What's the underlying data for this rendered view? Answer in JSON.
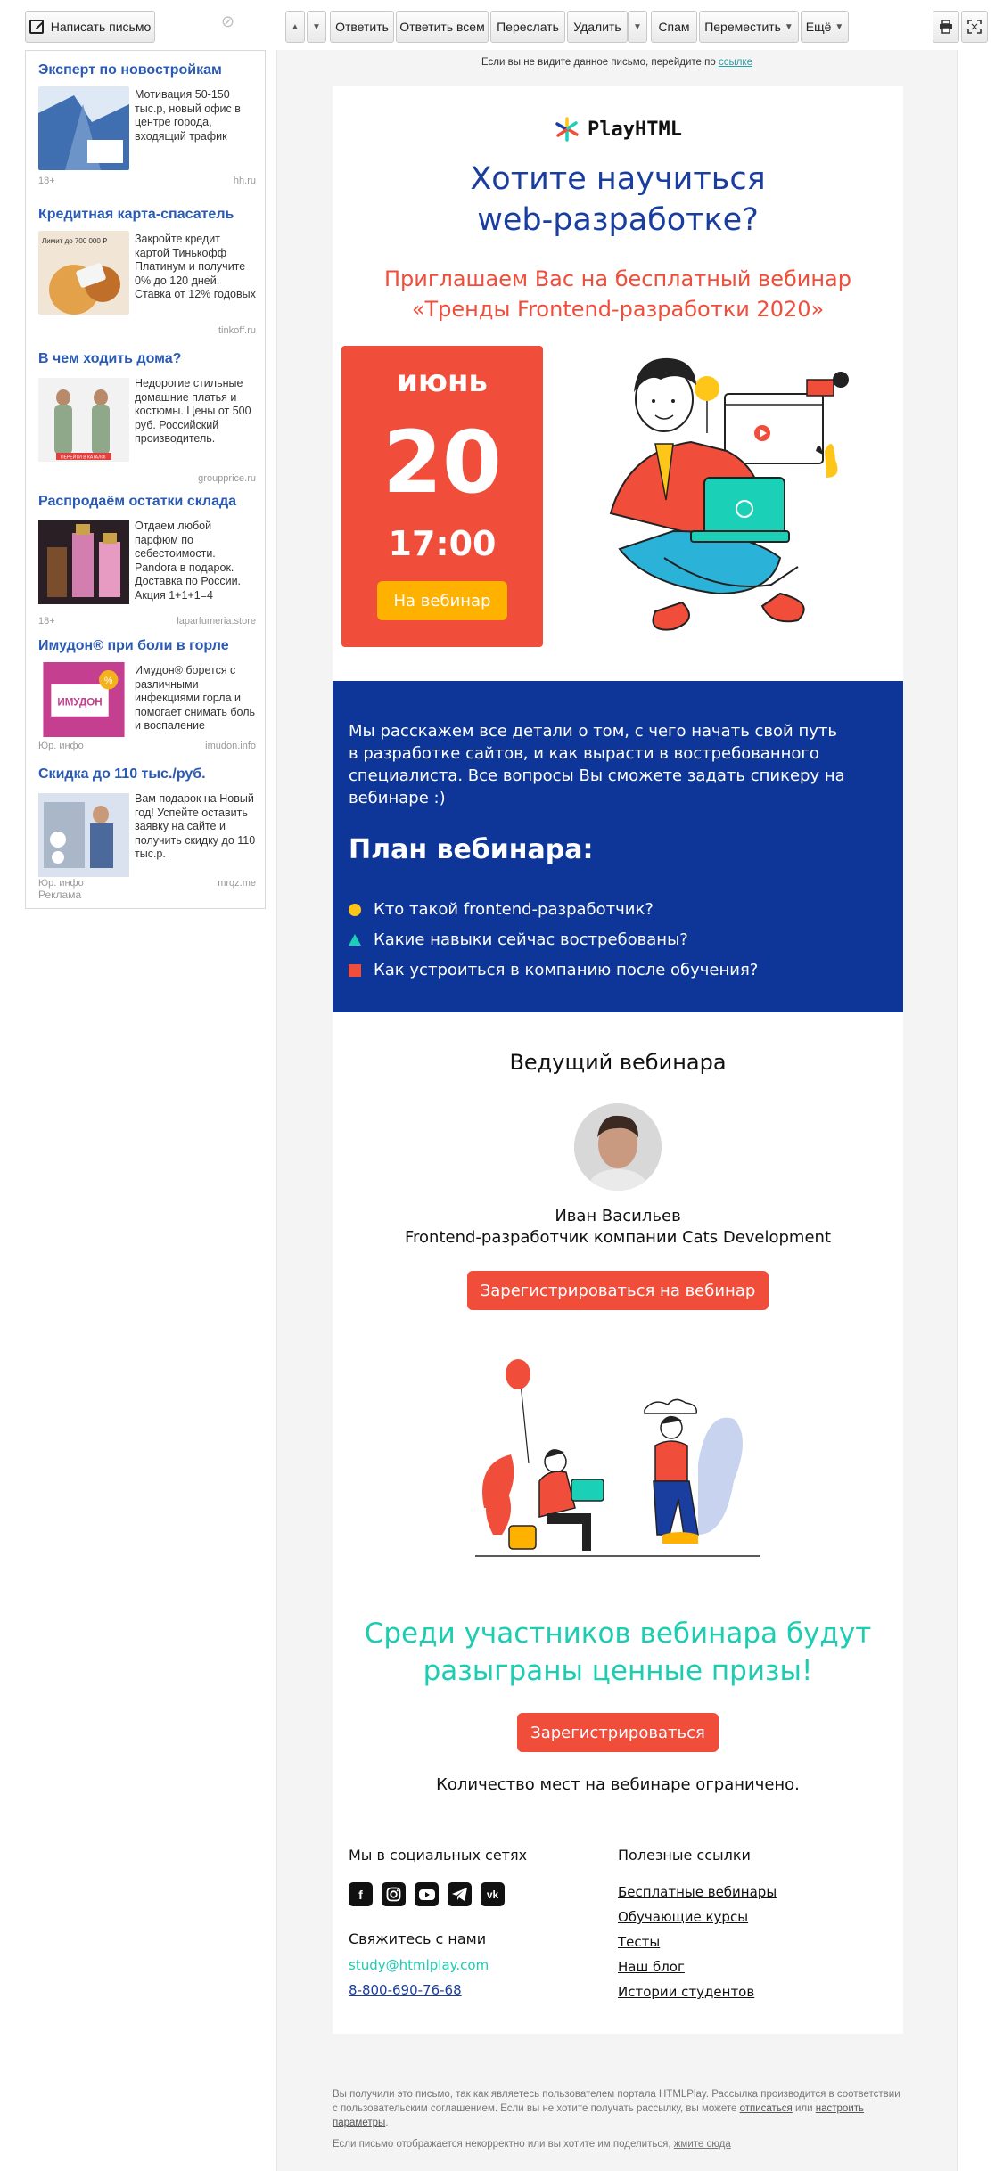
{
  "toolbar": {
    "compose": "Написать письмо",
    "reply": "Ответить",
    "reply_all": "Ответить всем",
    "forward": "Переслать",
    "delete": "Удалить",
    "spam": "Спам",
    "move": "Переместить",
    "more": "Ещё"
  },
  "ads": {
    "label": "Реклама",
    "items": [
      {
        "title": "Эксперт по новостройкам",
        "text": "Мотивация 50-150 тыс.р, новый офис в центре города, входящий трафик",
        "foot_left": "18+",
        "foot_right": "hh.ru",
        "img_color": "#3f6fb0"
      },
      {
        "title": "Кредитная карта-спасатель",
        "text": "Закройте кредит картой Тинькофф Платинум и получите 0% до 120 дней. Ставка от 12% годовых",
        "foot_left": "",
        "foot_right": "tinkoff.ru",
        "img_color": "#e3a24a",
        "img_text": "Лимит до 700 000 ₽"
      },
      {
        "title": "В чем ходить дома?",
        "text": "Недорогие стильные домашние платья и костюмы. Цены от 500 руб. Российский производитель.",
        "foot_left": "",
        "foot_right": "groupprice.ru",
        "img_color": "#8fa889",
        "img_text": "ПЕРЕЙТИ В КАТАЛОГ"
      },
      {
        "title": "Распродаём остатки склада",
        "text": "Отдаем любой парфюм по себестоимости. Pandora в подарок. Доставка по России. Акция 1+1+1=4",
        "foot_left": "18+",
        "foot_right": "laparfumeria.store",
        "img_color": "#4a3140"
      },
      {
        "title": "Имудон® при боли в горле",
        "text": "Имудон® борется с различными инфекциями горла и помогает снимать боль и воспаление",
        "foot_left": "Юр. инфо",
        "foot_right": "imudon.info",
        "img_color": "#c43f8f",
        "img_text": "ИМУДОН"
      },
      {
        "title": "Скидка до 110 тыс./руб.",
        "text": "Вам подарок на Новый год! Успейте оставить заявку на сайте и получить скидку до 110 тыс.р.",
        "foot_left": "Юр. инфо",
        "foot_right": "mrqz.me",
        "img_color": "#a9b7c9"
      }
    ]
  },
  "email": {
    "preheader": "Если вы не видите данное письмо, перейдите по",
    "preheader_link": "ссылке",
    "logo": "PlayHTML",
    "headline_1": "Хотите научиться",
    "headline_2": "web-разработке?",
    "invite_1": "Приглашаем Вас на бесплатный вебинар",
    "invite_2": "«Тренды Frontend-разработки 2020»",
    "date_month": "июнь",
    "date_day": "20",
    "date_time": "17:00",
    "date_button": "На вебинар",
    "about": "Мы расскажем все детали о том, с чего начать свой путь в разработке сайтов, и как вырасти в востребованного специалиста. Все вопросы Вы сможете задать спикеру на вебинаре :)",
    "plan_title": "План вебинара:",
    "plan": [
      "Кто такой frontend-разработчик?",
      "Какие навыки сейчас востребованы?",
      "Как устроиться в компанию после обучения?"
    ],
    "host_title": "Ведущий вебинара",
    "host_name": "Иван Васильев",
    "host_role": "Frontend-разработчик компании Cats Development",
    "register_webinar": "Зарегистрироваться на вебинар",
    "prize_1": "Среди участников вебинара будут",
    "prize_2": "разыграны ценные призы!",
    "register": "Зарегистрироваться",
    "limited": "Количество мест на вебинаре ограничено.",
    "social_title": "Мы в социальных сетях",
    "social_icons": [
      "facebook-icon",
      "instagram-icon",
      "youtube-icon",
      "telegram-icon",
      "vk-icon"
    ],
    "contact_title": "Свяжитесь с нами",
    "email_addr": "study@htmlplay.com",
    "phone": "8-800-690-76-68",
    "links_title": "Полезные ссылки",
    "links": [
      "Бесплатные вебинары",
      "Обучающие курсы",
      "Тесты",
      "Наш блог",
      "Истории студентов"
    ]
  },
  "legal": {
    "text_1": "Вы получили это письмо, так как являетесь пользователем портала HTMLPlay. Рассылка производится в соответствии с пользовательским соглашением. Если вы не хотите получать рассылку, вы можете",
    "unsubscribe": "отписаться",
    "text_2": "или",
    "settings": "настроить параметры",
    "text_3": "Если письмо отображается некорректно или вы хотите им поделиться,",
    "share": "жмите сюда"
  },
  "colors": {
    "brand_blue": "#1a3ea0",
    "accent_red": "#f04d3a",
    "accent_teal": "#1ccdb2",
    "accent_yellow": "#ffb100",
    "block_blue": "#0d3698"
  }
}
